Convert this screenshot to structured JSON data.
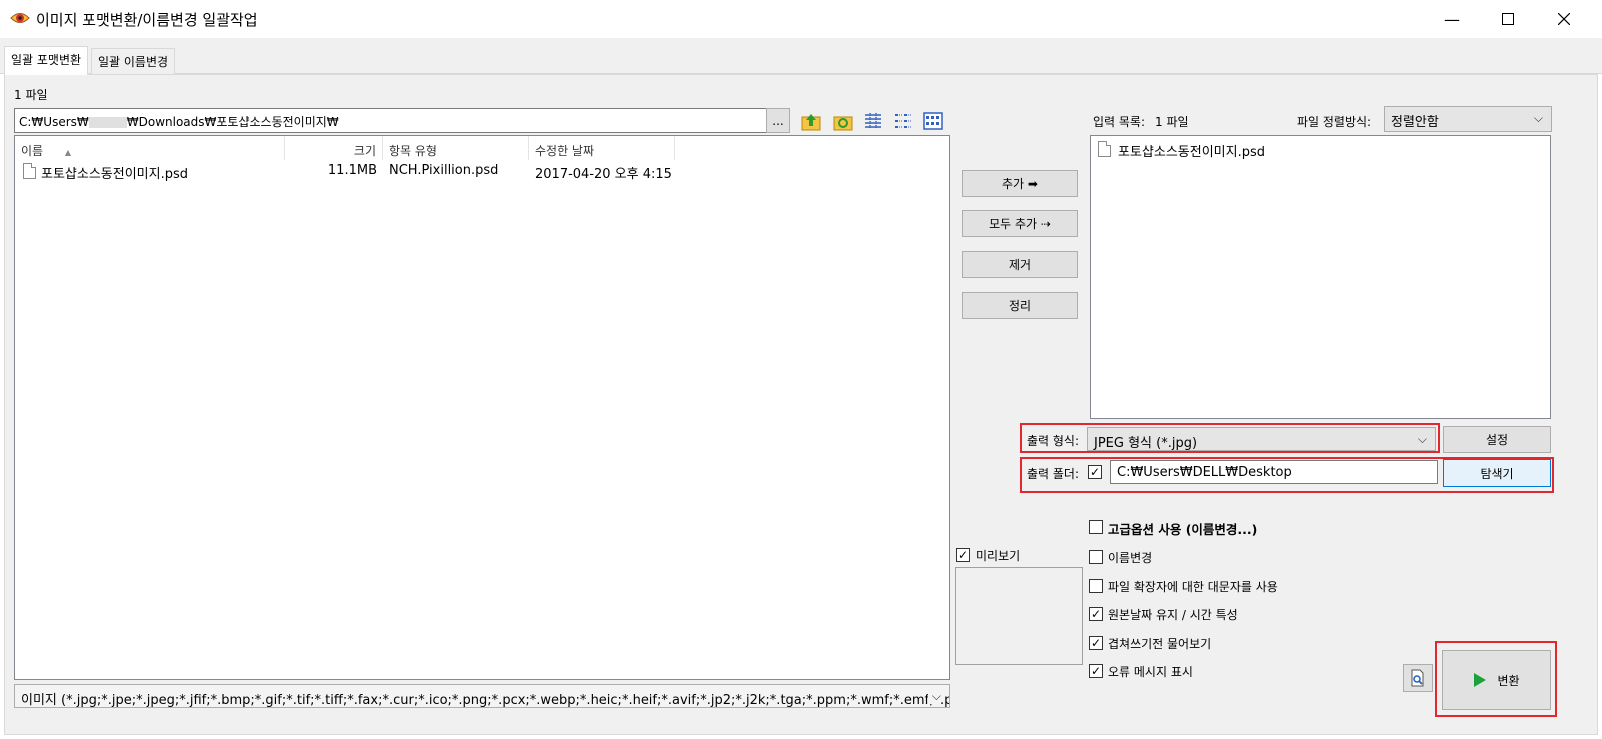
{
  "window": {
    "title": "이미지 포맷변환/이름변경 일괄작업",
    "minimize": "—",
    "maximize": "☐",
    "close": "✕"
  },
  "tabs": [
    {
      "label": "일괄 포맷변환",
      "active": true
    },
    {
      "label": "일괄 이름변경",
      "active": false
    }
  ],
  "source": {
    "file_count": "1 파일",
    "path_prefix": "C:₩Users₩",
    "path_suffix": "₩Downloads₩포토샵소스동전이미지₩",
    "browse_label": "...",
    "columns": [
      "이름",
      "크기",
      "항목 유형",
      "수정한 날짜"
    ],
    "sort_glyph": "▲",
    "files": [
      {
        "name": "포토샵소스동전이미지.psd",
        "size": "11.1MB",
        "type": "NCH.Pixillion.psd",
        "date": "2017-04-20 오후 4:15"
      }
    ],
    "filter": "이미지 (*.jpg;*.jpe;*.jpeg;*.jfif;*.bmp;*.gif;*.tif;*.tiff;*.fax;*.cur;*.ico;*.png;*.pcx;*.webp;*.heic;*.heif;*.avif;*.jp2;*.j2k;*.tga;*.ppm;*.wmf;*.emf;*.psd;*.crw;*.nef;*.cr"
  },
  "middle": {
    "add": "추가 ➡",
    "add_all": "모두 추가 ⇢",
    "remove": "제거",
    "clear": "정리",
    "preview_label": "미리보기",
    "preview_checked": true
  },
  "input_list": {
    "label": "입력 목록:",
    "count": "1 파일",
    "sort_label": "파일 정렬방식:",
    "sort_value": "정렬안함",
    "files": [
      "포토샵소스동전이미지.psd"
    ]
  },
  "output": {
    "format_label": "출력 형식:",
    "format_value": "JPEG 형식 (*.jpg)",
    "settings": "설정",
    "folder_label": "출력 폴더:",
    "folder_checked": true,
    "folder_value": "C:₩Users₩DELL₩Desktop",
    "browse": "탐색기"
  },
  "options": {
    "advanced": "고급옵션 사용 (이름변경...)",
    "rename": "이름변경",
    "uppercase_ext": "파일 확장자에 대한 대문자를 사용",
    "keep_date": "원본날짜 유지 / 시간 특성",
    "ask_overwrite": "겹쳐쓰기전 물어보기",
    "show_errors": "오류 메시지 표시",
    "checked_mark": "✓"
  },
  "convert": "변환",
  "colors": {
    "highlight": "#e0282e",
    "accent_blue": "#0078d7",
    "play_green": "#1aa33a"
  }
}
